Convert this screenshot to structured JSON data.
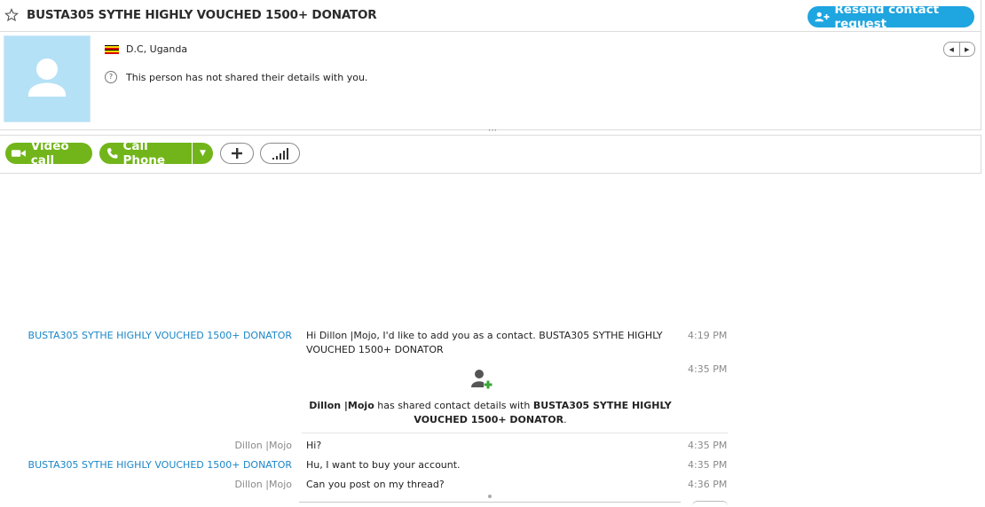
{
  "header": {
    "title": "BUSTA305 SYTHE HIGHLY VOUCHED 1500+ DONATOR",
    "resend_label": "Resend contact request"
  },
  "profile": {
    "location": "D.C, Uganda",
    "status": "This person has not shared their details with you.",
    "help_glyph": "?"
  },
  "actions": {
    "video_label": "Video call",
    "phone_label": "Call Phone"
  },
  "messages": [
    {
      "sender": "BUSTA305 SYTHE HIGHLY VOUCHED 1500+ DONATOR",
      "text": "Hi Dillon |Mojo, I'd like to add you as a contact. BUSTA305 SYTHE HIGHLY VOUCHED 1500+ DONATOR",
      "time": "4:19 PM"
    },
    {
      "sender": "",
      "text": "",
      "time": "4:35 PM"
    },
    {
      "sender": "Dillon |Mojo",
      "text": "Hi?",
      "time": "4:35 PM"
    },
    {
      "sender": "BUSTA305 SYTHE HIGHLY VOUCHED 1500+ DONATOR",
      "text": "Hu, I want to buy your account.",
      "time": "4:35 PM"
    },
    {
      "sender": "Dillon |Mojo",
      "text": "Can you post on my thread?",
      "time": "4:36 PM"
    }
  ],
  "system_message": {
    "actor": "Dillon  |Mojo",
    "middle": " has shared contact details with ",
    "target": "BUSTA305 SYTHE HIGHLY VOUCHED 1500+ DONATOR",
    "end": "."
  },
  "colors": {
    "accent_blue": "#1fa5e0",
    "call_green": "#72b51b",
    "sender_blue": "#1a86c8",
    "avatar_bg": "#b5e1f7"
  },
  "icons": [
    "star-icon",
    "add-contact-icon",
    "user-silhouette-icon",
    "uganda-flag-icon",
    "help-icon",
    "video-icon",
    "phone-icon",
    "chevron-down-icon",
    "plus-icon",
    "signal-bars-icon",
    "contact-shared-icon"
  ]
}
